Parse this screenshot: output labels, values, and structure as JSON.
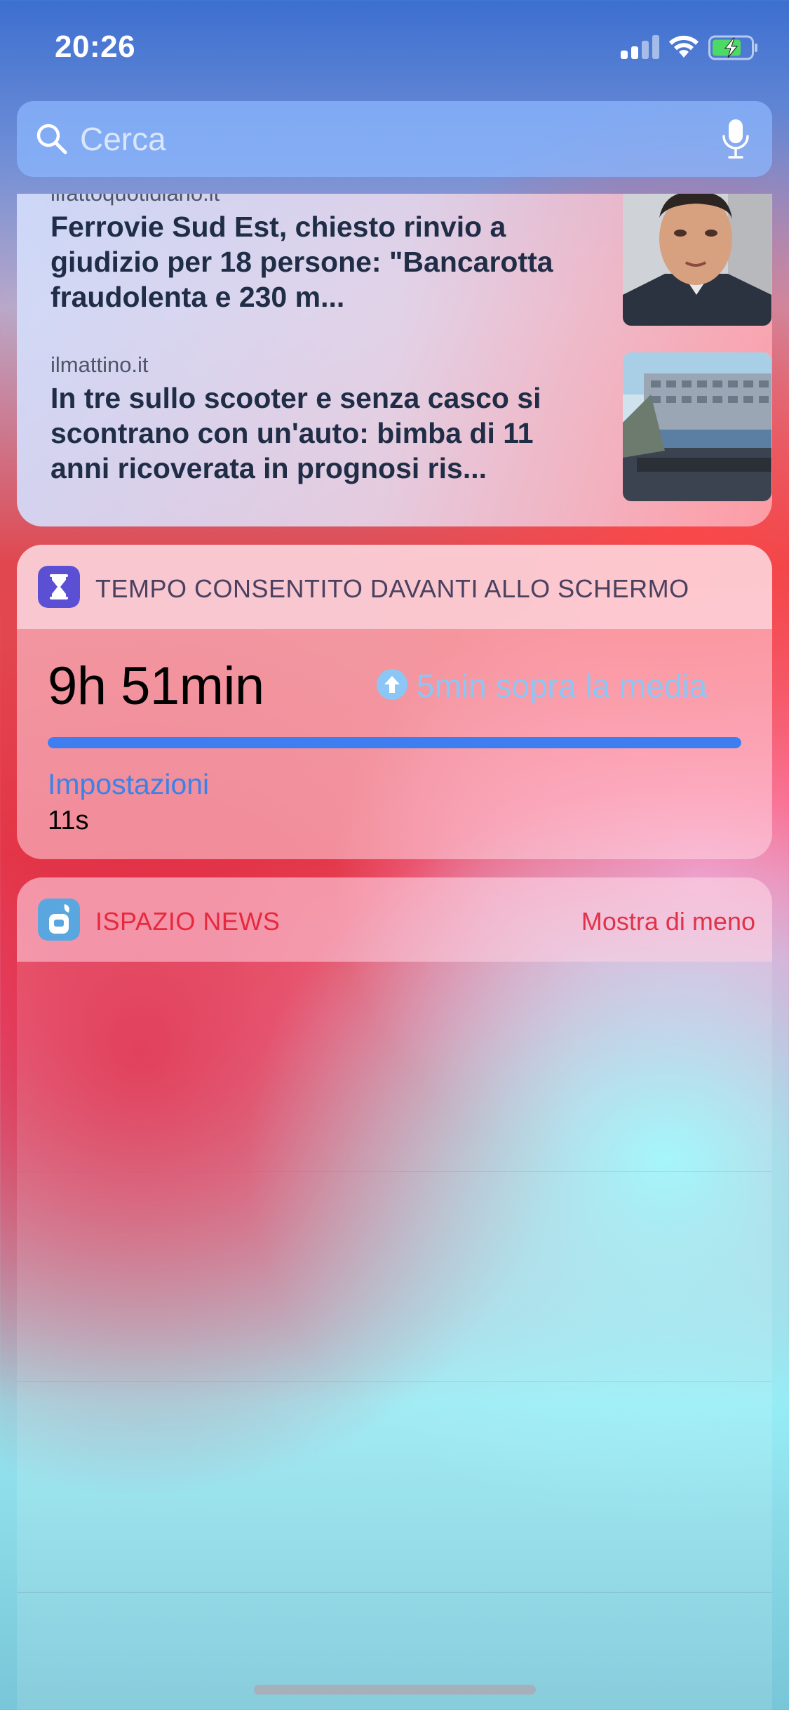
{
  "status_bar": {
    "time": "20:26"
  },
  "search": {
    "placeholder": "Cerca"
  },
  "news": {
    "items": [
      {
        "source": "ilfattoquotidiano.it",
        "title": "Ferrovie Sud Est, chiesto rinvio a giudizio per 18 persone: \"Bancarotta fraudolenta e 230 m..."
      },
      {
        "source": "ilmattino.it",
        "title": "In tre sullo scooter e senza casco si scontrano con un'auto: bimba di 11 anni ricoverata in prognosi ris..."
      }
    ]
  },
  "screen_time": {
    "title": "TEMPO CONSENTITO DAVANTI ALLO SCHERMO",
    "total": "9h 51min",
    "comparison": "5min sopra la media",
    "app_name": "Impostazioni",
    "app_time": "11s",
    "bar_color": "#3f7ef0",
    "icon": "hourglass-icon"
  },
  "ispazio": {
    "title": "ISPAZIO NEWS",
    "toggle_label": "Mostra di meno",
    "icon": "ispazio-app-icon"
  },
  "colors": {
    "accent_blue": "#3b82e8",
    "accent_red": "#e8283d",
    "screen_time_icon_bg": "#5b4fd4"
  }
}
